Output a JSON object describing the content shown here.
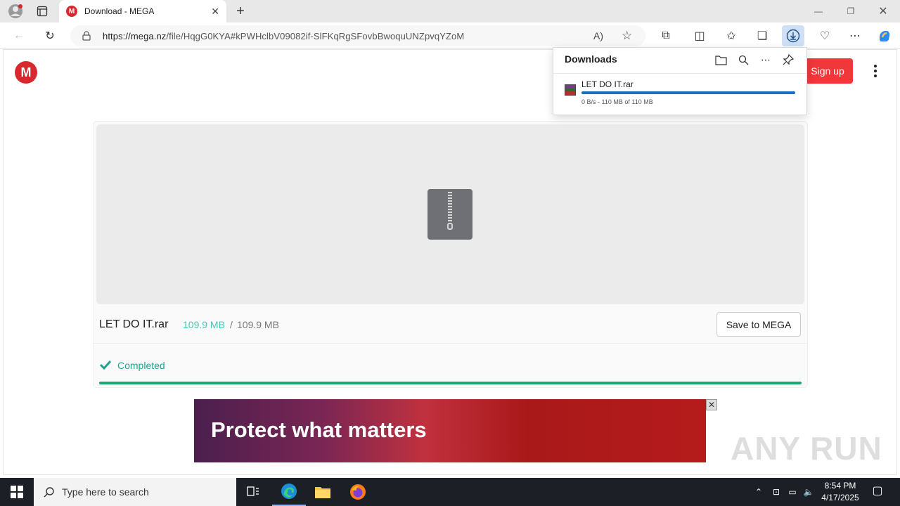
{
  "browser": {
    "tab_title": "Download - MEGA",
    "tab_favicon": "M",
    "url_host": "https://mega.nz",
    "url_path": "/file/HqgG0KYA#kPWHclbV09082if-SlFKqRgSFovbBwoquUNZpvqYZoM"
  },
  "page": {
    "logo_letter": "M",
    "signup_label": "Sign up",
    "file_name": "LET DO IT.rar",
    "size_done": "109.9 MB",
    "size_sep": "/",
    "size_total": "109.9 MB",
    "save_label": "Save to MEGA",
    "status": "Completed",
    "progress": 1.0
  },
  "ad": {
    "headline": "Protect what matters",
    "close": "✕"
  },
  "watermark": "ANY RUN",
  "downloads": {
    "title": "Downloads",
    "file_name": "LET DO IT.rar",
    "meta": "0 B/s - 110 MB of 110 MB",
    "progress": 1.0
  },
  "taskbar": {
    "search_placeholder": "Type here to search",
    "time": "8:54 PM",
    "date": "4/17/2025"
  },
  "colors": {
    "mega_red": "#d9272e",
    "signup_red": "#f0373a",
    "complete_green": "#1fa673",
    "size_teal": "#4cc5b8",
    "download_blue": "#1a6fc2"
  }
}
